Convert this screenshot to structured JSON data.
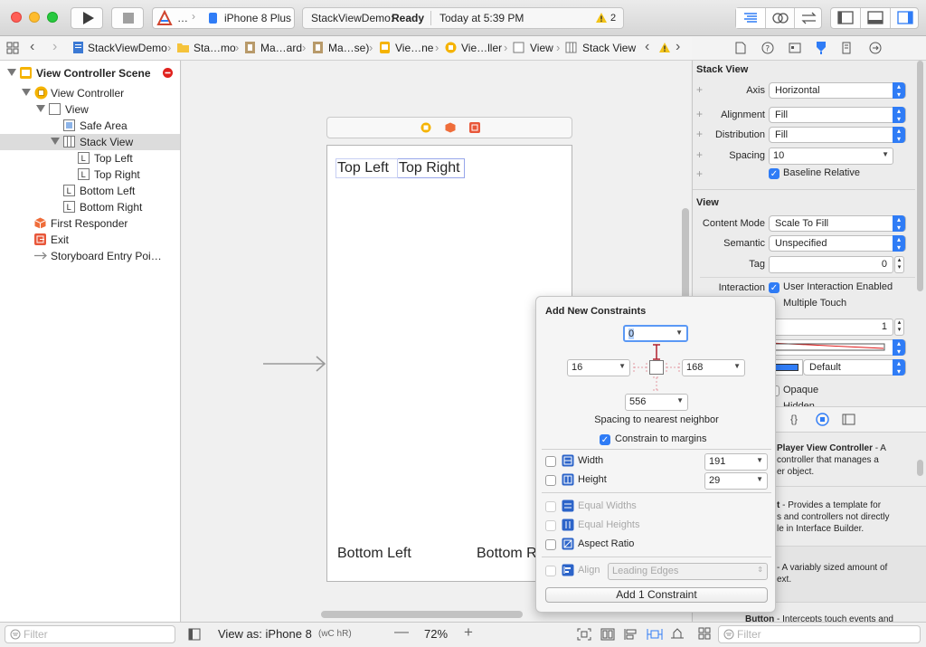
{
  "toolbar": {
    "scheme": "…",
    "device": "iPhone 8 Plus",
    "status_project": "StackViewDemo:",
    "status_state": "Ready",
    "status_time": "Today at 5:39 PM",
    "warning_count": "2"
  },
  "jumpbar": {
    "items": [
      "StackViewDemo",
      "Sta…mo",
      "Ma…ard",
      "Ma…se)",
      "Vie…ne",
      "Vie…ller",
      "View",
      "Stack View"
    ]
  },
  "outline": {
    "scene": "View Controller Scene",
    "view_controller": "View Controller",
    "view": "View",
    "safe_area": "Safe Area",
    "stack_view": "Stack View",
    "top_left": "Top Left",
    "top_right": "Top Right",
    "bottom_left": "Bottom Left",
    "bottom_right": "Bottom Right",
    "first_responder": "First Responder",
    "exit": "Exit",
    "entry_point": "Storyboard Entry Poi…",
    "filter_placeholder": "Filter"
  },
  "canvas": {
    "top_left_label": "Top Left",
    "top_right_label": "Top Right",
    "bottom_left_label": "Bottom Left",
    "bottom_right_label": "Bottom R",
    "view_as": "View as: iPhone 8",
    "size_class": "(wC hR)",
    "zoom": "72%"
  },
  "inspector": {
    "stack_view_title": "Stack View",
    "axis_label": "Axis",
    "axis_value": "Horizontal",
    "alignment_label": "Alignment",
    "alignment_value": "Fill",
    "distribution_label": "Distribution",
    "distribution_value": "Fill",
    "spacing_label": "Spacing",
    "spacing_value": "10",
    "baseline_label": "Baseline Relative",
    "view_title": "View",
    "content_mode_label": "Content Mode",
    "content_mode_value": "Scale To Fill",
    "semantic_label": "Semantic",
    "semantic_value": "Unspecified",
    "tag_label": "Tag",
    "tag_value": "0",
    "interaction_label": "Interaction",
    "user_interaction": "User Interaction Enabled",
    "multiple_touch": "Multiple Touch",
    "alpha_value": "1",
    "background_value": "Default",
    "opaque": "Opaque",
    "hidden": "Hidden",
    "filter_placeholder": "Filter"
  },
  "library": {
    "item1_title": "Player View Controller",
    "item1_desc1": " - A",
    "item1_desc2": "controller that manages a",
    "item1_desc3": "er object.",
    "item2_title": "t",
    "item2_desc1": " - Provides a template for",
    "item2_desc2": "s and controllers not directly",
    "item2_desc3": "le in Interface Builder.",
    "item3_desc1": " - A variably sized amount of",
    "item3_desc2": "ext.",
    "item4_title": "Button",
    "item4_desc1": " - Intercepts touch events and"
  },
  "constraints_popover": {
    "title": "Add New Constraints",
    "top": "0",
    "left": "16",
    "right": "168",
    "bottom": "556",
    "spacing_caption": "Spacing to nearest neighbor",
    "constrain_margins": "Constrain to margins",
    "width_label": "Width",
    "width_value": "191",
    "height_label": "Height",
    "height_value": "29",
    "equal_widths": "Equal Widths",
    "equal_heights": "Equal Heights",
    "aspect_ratio": "Aspect Ratio",
    "align_label": "Align",
    "align_value": "Leading Edges",
    "add_button": "Add 1 Constraint"
  },
  "colors": {
    "accent": "#2f7cf6",
    "warning": "#f2c318",
    "scene_icon": "#f5b300",
    "close_red": "#ff5f57",
    "minimize_yellow": "#febc2e",
    "zoom_green": "#28c840"
  }
}
